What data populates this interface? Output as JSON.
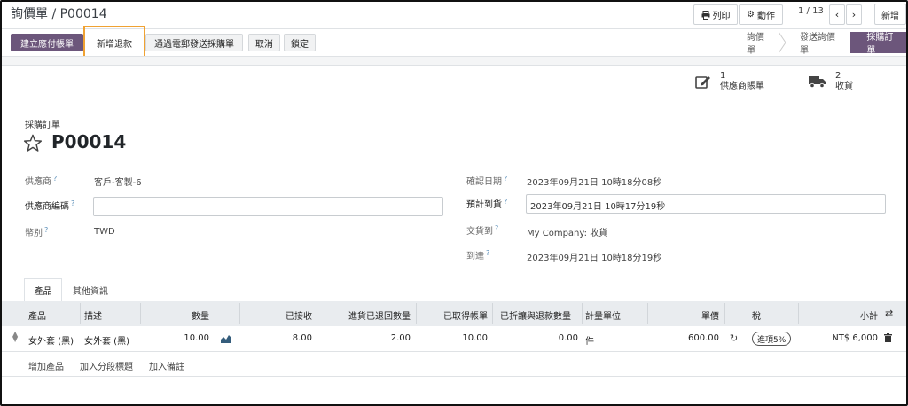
{
  "header": {
    "breadcrumb": "詢價單 / P00014",
    "print_label": "列印",
    "action_label": "動作",
    "pager": "1 / 13",
    "new_label": "新增"
  },
  "actions": {
    "create_bill": "建立應付帳單",
    "add_refund": "新增退款",
    "send_email": "通過電郵發送採購單",
    "cancel": "取消",
    "lock": "鎖定"
  },
  "status": {
    "stages": [
      "詢價單",
      "發送詢價單",
      "採購訂單"
    ],
    "active_index": 2
  },
  "smart_buttons": [
    {
      "icon": "edit-icon",
      "count": "1",
      "label": "供應商賬單"
    },
    {
      "icon": "truck-icon",
      "count": "2",
      "label": "收貨"
    }
  ],
  "form": {
    "doc_type": "採購訂單",
    "title": "P00014",
    "vendor_label": "供應商",
    "vendor_value": "客戶-客製-6",
    "vendor_ref_label": "供應商編碼",
    "vendor_ref_value": "",
    "currency_label": "幣別",
    "currency_value": "TWD",
    "confirm_date_label": "確認日期",
    "confirm_date_value": "2023年09月21日 10時18分08秒",
    "expected_label": "預計到貨",
    "expected_value": "2023年09月21日 10時17分19秒",
    "deliver_to_label": "交貨到",
    "deliver_to_value": "My Company: 收貨",
    "arrival_label": "到達",
    "arrival_value": "2023年09月21日 10時18分19秒"
  },
  "tabs": [
    "產品",
    "其他資訊"
  ],
  "table": {
    "headers": {
      "product": "產品",
      "description": "描述",
      "qty": "數量",
      "received": "已接收",
      "returned": "進貨已退回數量",
      "billed": "已取得帳單",
      "refunded": "已折讓與退款數量",
      "uom": "計量單位",
      "price": "單價",
      "tax": "稅",
      "subtotal": "小計"
    },
    "rows": [
      {
        "product": "女外套 (黑)",
        "description": "女外套 (黑)",
        "qty": "10.00",
        "received": "8.00",
        "returned": "2.00",
        "billed": "10.00",
        "refunded": "0.00",
        "uom": "件",
        "price": "600.00",
        "tax": "進項5%",
        "subtotal": "NT$ 6,000"
      }
    ],
    "links": {
      "add_product": "增加產品",
      "add_section": "加入分段標題",
      "add_note": "加入備註"
    }
  },
  "colors": {
    "primary": "#6c567b",
    "highlight": "#f0a232",
    "table_header": "#e9ecef"
  }
}
